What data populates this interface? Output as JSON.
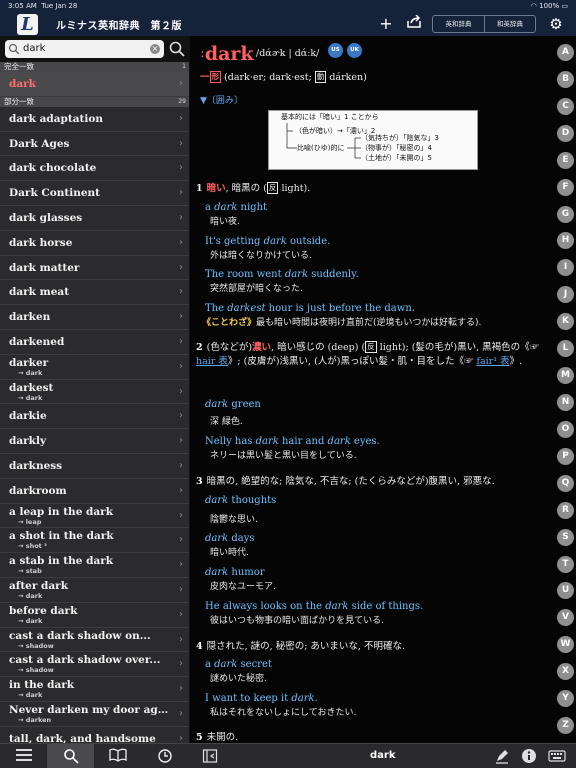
{
  "status": {
    "time": "3:05 AM",
    "date": "Tue Jan 28",
    "battery": "100%"
  },
  "app": {
    "icon_letter": "L",
    "title": "ルミナス英和辞典　第２版"
  },
  "dict_tabs": [
    "英和辞典",
    "和英辞典"
  ],
  "search": {
    "value": "dark"
  },
  "sections": {
    "exact": {
      "label": "完全一致",
      "count": "1"
    },
    "partial": {
      "label": "部分一致",
      "count": "29"
    }
  },
  "exact_items": [
    {
      "word": "dark"
    }
  ],
  "partial_items": [
    {
      "word": "dark adaptation",
      "sub": ""
    },
    {
      "word": "Dark Ages",
      "sub": ""
    },
    {
      "word": "dark chocolate",
      "sub": ""
    },
    {
      "word": "Dark Continent",
      "sub": ""
    },
    {
      "word": "dark glasses",
      "sub": ""
    },
    {
      "word": "dark horse",
      "sub": ""
    },
    {
      "word": "dark matter",
      "sub": ""
    },
    {
      "word": "dark meat",
      "sub": ""
    },
    {
      "word": "darken",
      "sub": ""
    },
    {
      "word": "darkened",
      "sub": ""
    },
    {
      "word": "darker",
      "sub": "→ dark"
    },
    {
      "word": "darkest",
      "sub": "→ dark"
    },
    {
      "word": "darkie",
      "sub": ""
    },
    {
      "word": "darkly",
      "sub": ""
    },
    {
      "word": "darkness",
      "sub": ""
    },
    {
      "word": "darkroom",
      "sub": ""
    },
    {
      "word": "a leap in the dark",
      "sub": "→ leap"
    },
    {
      "word": "a shot in the dark",
      "sub": "→ shot ³"
    },
    {
      "word": "a stab in the dark",
      "sub": "→ stab"
    },
    {
      "word": "after dark",
      "sub": "→ dark"
    },
    {
      "word": "before dark",
      "sub": "→ dark"
    },
    {
      "word": "cast a dark shadow on...",
      "sub": "→ shadow"
    },
    {
      "word": "cast a dark shadow over...",
      "sub": "→ shadow"
    },
    {
      "word": "in the dark",
      "sub": "→ dark"
    },
    {
      "word": "Never darken my door agai...",
      "sub": "→ darken"
    },
    {
      "word": "tall, dark, and handsome",
      "sub": ""
    }
  ],
  "entry": {
    "headword": "dark",
    "pronunciation": "/dάɚk | dάːk/",
    "audio_us": "US",
    "audio_uk": "UK",
    "pos": "形",
    "inflection": "(dark·er; dark·est;",
    "verb_tag": "動",
    "verb_form": "dárken)",
    "toggle": "▼〔囲み〕",
    "diagram": {
      "top": "基本的には「暗い」1 ことから",
      "l1": "（色が暗い）→「濃い」2",
      "l2": "（気持ちが）「陰気な」3",
      "l3": "比喩(ひゆ)的に",
      "l4": "（物事が）「秘密の」4",
      "l5": "（土地が）「未開の」5"
    },
    "sense1": {
      "num": "1",
      "kw": "暗い",
      "rest": ", 暗黒の (",
      "ant": "反",
      "ant_word": " light)."
    },
    "ex1": {
      "pre": "a ",
      "it": "dark",
      "post": " night",
      "tr": "暗い夜."
    },
    "ex2": {
      "pre": "It's getting ",
      "it": "dark",
      "post": " outside.",
      "tr": "外は暗くなりかけている."
    },
    "ex3": {
      "pre": "The room went ",
      "it": "dark",
      "post": " suddenly.",
      "tr": "突然部屋が暗くなった."
    },
    "ex4": {
      "pre": "The ",
      "it": "darkest",
      "post": " hour is just before the dawn.",
      "kw": "《ことわざ》",
      "tr": "最も暗い時間は夜明け直前だ(逆境もいつかは好転する)."
    },
    "sense2": {
      "num": "2",
      "a": "(色などが)",
      "kw": "濃い",
      "b": ", 暗い感じの (deep) (",
      "ant": "反",
      "c": " light); (髪の毛が)黒い, 黒褐色の《☞ ",
      "ref1": "hair 表",
      "d": "》; (皮膚が)浅黒い, (人が)黒っぽい髪・肌・目をした《☞ ",
      "ref2": "fair¹ 表",
      "e": "》."
    },
    "ex5": {
      "it": "dark",
      "post": " green",
      "tr": "深 緑色."
    },
    "ex6": {
      "pre": "Nelly has ",
      "it": "dark",
      "mid": " hair and ",
      "it2": "dark",
      "post": " eyes.",
      "tr": "ネリーは黒い髪と黒い目をしている."
    },
    "sense3": {
      "num": "3",
      "text": "暗黒の, 絶望的な; 陰気な, 不吉な; (たくらみなどが)腹黒い, 邪悪な."
    },
    "ex7": {
      "it": "dark",
      "post": " thoughts",
      "tr": "陰鬱な思い."
    },
    "ex8": {
      "it": "dark",
      "post": " days",
      "tr": "暗い時代."
    },
    "ex9": {
      "it": "dark",
      "post": " humor",
      "tr": "皮肉なユーモア."
    },
    "ex10": {
      "pre": "He always looks on the ",
      "it": "dark",
      "post": " side of things.",
      "tr": "彼はいつも物事の暗い面ばかりを見ている."
    },
    "sense4": {
      "num": "4",
      "text": "隠された, 謎の, 秘密の; あいまいな, 不明確な."
    },
    "ex11": {
      "pre": "a ",
      "it": "dark",
      "post": " secret",
      "tr": "謎めいた秘密."
    },
    "ex12": {
      "pre": "I want to keep it ",
      "it": "dark",
      "post": ".",
      "tr": "私はそれをないしょにしておきたい."
    },
    "sense5": {
      "num": "5",
      "text": "未開の."
    }
  },
  "index_letters": [
    "A",
    "B",
    "C",
    "D",
    "E",
    "F",
    "G",
    "H",
    "I",
    "J",
    "K",
    "L",
    "M",
    "N",
    "O",
    "P",
    "Q",
    "R",
    "S",
    "T",
    "U",
    "V",
    "W",
    "X",
    "Y",
    "Z"
  ],
  "bottom": {
    "current_word": "dark"
  },
  "icons": [
    "search-icon",
    "clear-icon",
    "plus-icon",
    "share-icon",
    "gear-icon",
    "list-icon",
    "book-icon",
    "history-icon",
    "sidebar-icon",
    "marker-icon",
    "info-icon",
    "keyboard-icon"
  ]
}
